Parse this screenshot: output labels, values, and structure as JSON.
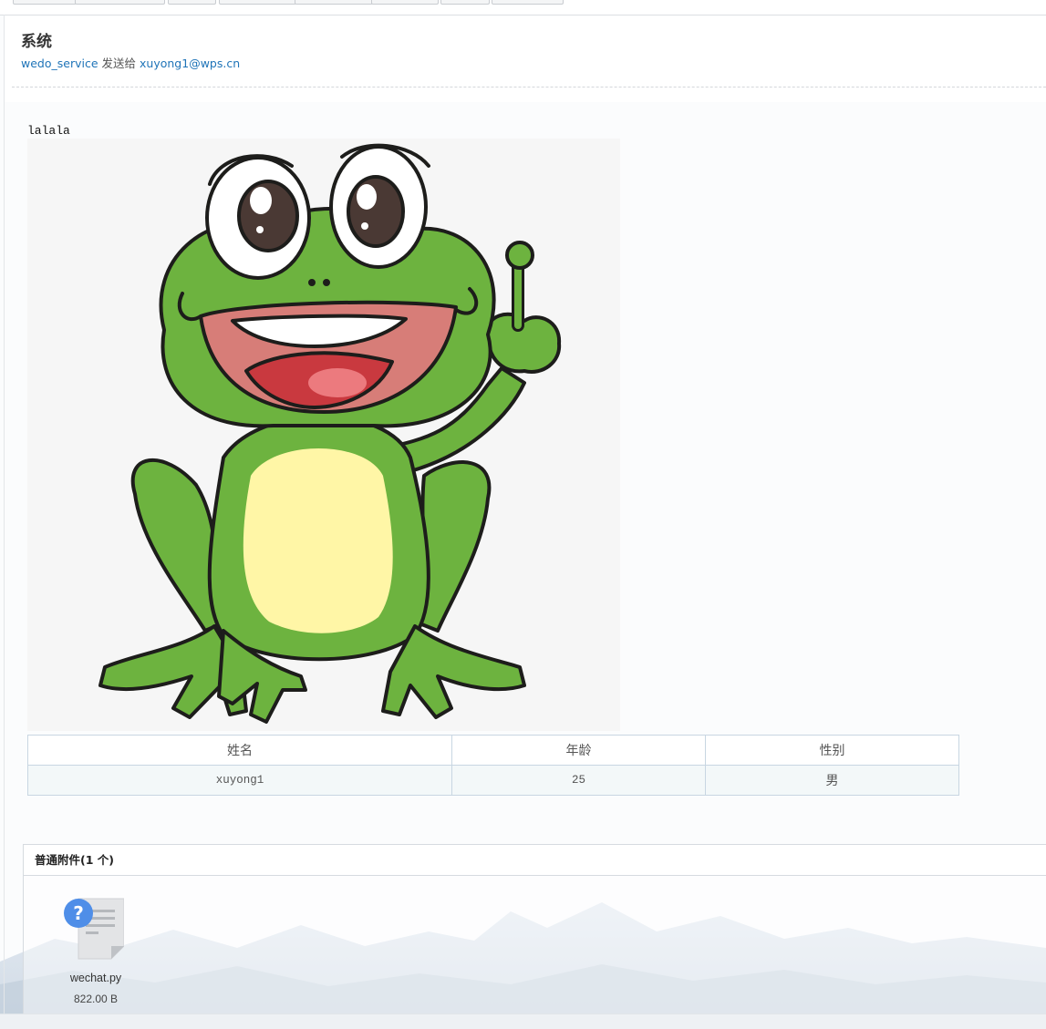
{
  "header": {
    "subject": "系统",
    "sender": "wedo_service",
    "sent_to_label": "发送给",
    "recipient": "xuyong1@wps.cn"
  },
  "body": {
    "text": "lalala",
    "image": "frog-illustration",
    "table": {
      "headers": [
        "姓名",
        "年龄",
        "性别"
      ],
      "rows": [
        [
          "xuyong1",
          "25",
          "男"
        ]
      ]
    }
  },
  "attachments": {
    "title": "普通附件(1 个)",
    "files": [
      {
        "name": "wechat.py",
        "size": "822.00 B",
        "icon": "unknown-file-icon"
      }
    ]
  }
}
